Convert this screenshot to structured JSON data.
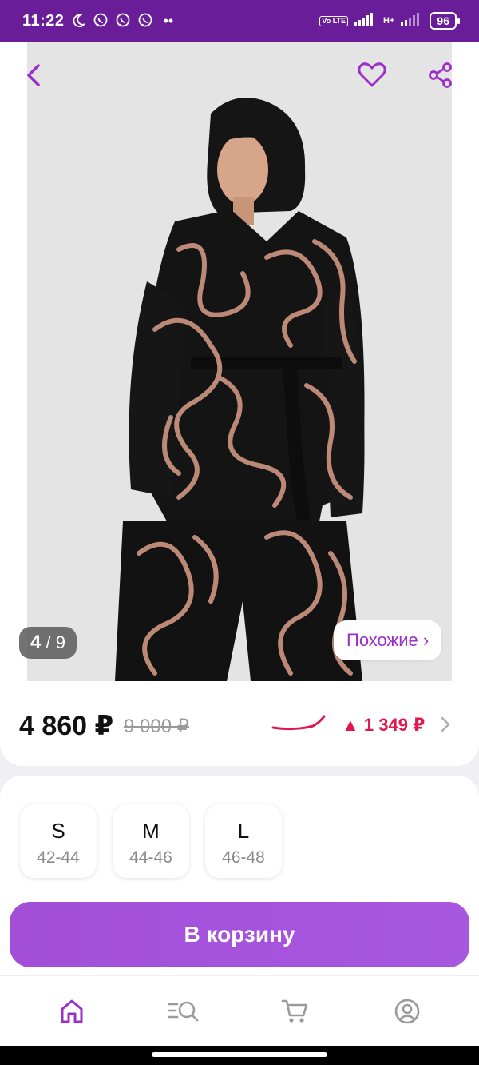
{
  "status_bar": {
    "time": "11:22",
    "network_badge": "Vo LTE",
    "network_type": "H+",
    "battery": "96"
  },
  "gallery": {
    "current": "4",
    "separator": "/",
    "total": "9",
    "similar_label": "Похожие ›"
  },
  "price": {
    "current": "4 860 ₽",
    "old": "9 000 ₽",
    "delta": "▲ 1 349 ₽"
  },
  "sizes": [
    {
      "label": "S",
      "range": "42-44"
    },
    {
      "label": "M",
      "range": "44-46"
    },
    {
      "label": "L",
      "range": "46-48"
    }
  ],
  "cart_button": "В корзину",
  "colors": {
    "brand": "#6a1d98",
    "accent": "#a14fd9",
    "price_up": "#e0174f"
  },
  "nav": [
    "home-icon",
    "catalog-search-icon",
    "cart-icon",
    "profile-icon"
  ]
}
